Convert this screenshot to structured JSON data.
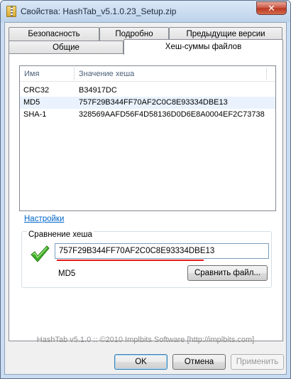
{
  "window": {
    "title": "Свойства: HashTab_v5.1.0.23_Setup.zip",
    "close_glyph": "✕"
  },
  "tabs": {
    "row_back": [
      "Безопасность",
      "Подробно",
      "Предыдущие версии"
    ],
    "row_front": [
      "Общие",
      "Хеш-суммы файлов"
    ],
    "active": "Хеш-суммы файлов"
  },
  "hash_list": {
    "columns": [
      "Имя",
      "Значение хеша"
    ],
    "rows": [
      {
        "name": "CRC32",
        "value": "B34917DC"
      },
      {
        "name": "MD5",
        "value": "757F29B344FF70AF2C0C8E93334DBE13"
      },
      {
        "name": "SHA-1",
        "value": "328569AAFD56F4D58136D0D6E8A0004EF2C73738"
      }
    ],
    "selected_row": 1
  },
  "settings_link": "Настройки",
  "comparison": {
    "legend": "Сравнение хеша",
    "input_value": "757F29B344FF70AF2C0C8E93334DBE13",
    "match_algorithm": "MD5",
    "compare_button": "Сравнить файл...",
    "status_icon": "green-check-icon"
  },
  "footer": "HashTab v5.1.0 :: ©2010 Implbits Software [http://implbits.com]",
  "buttons": {
    "ok": "OK",
    "cancel": "Отмена",
    "apply": "Применить"
  },
  "colors": {
    "accent_link": "#0066cc",
    "match_underline": "#e21a1a",
    "check_green": "#3fae29"
  }
}
